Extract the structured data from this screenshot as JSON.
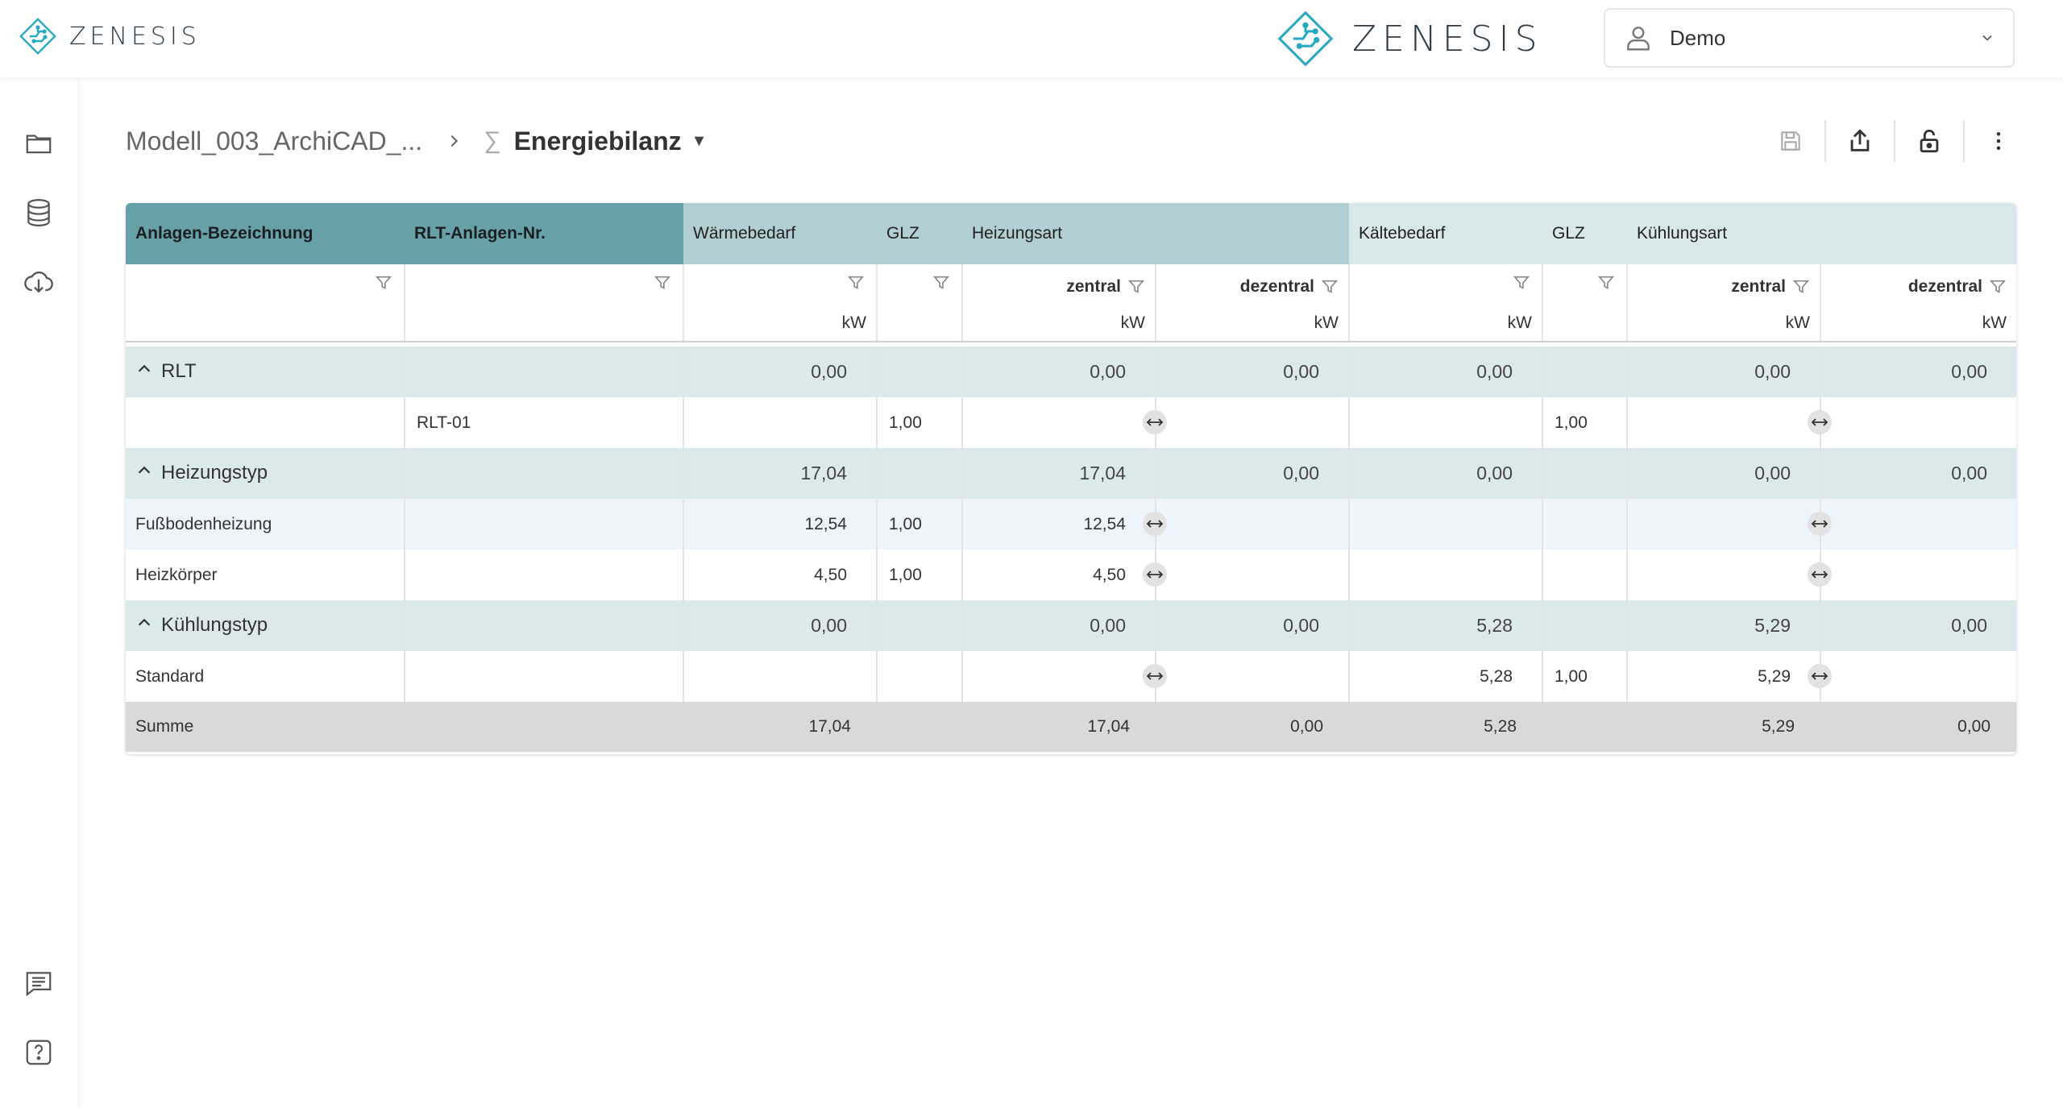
{
  "brand": {
    "name": "ZENESIS"
  },
  "user": {
    "name": "Demo"
  },
  "sidebar": {
    "icons": [
      "folder-icon",
      "database-icon",
      "cloud-download-icon",
      "message-icon",
      "help-icon"
    ]
  },
  "breadcrumb": {
    "model": "Modell_003_ArchiCAD_...",
    "sigma": "∑",
    "current": "Energiebilanz"
  },
  "toolbar": {
    "icons": [
      "save-icon",
      "export-icon",
      "unlock-icon",
      "more-icon"
    ]
  },
  "table": {
    "headers": {
      "anlagen": "Anlagen-Bezeichnung",
      "rlt": "RLT-Anlagen-Nr.",
      "waerme": "Wärmebedarf",
      "glz1": "GLZ",
      "heizungsart": "Heizungsart",
      "kaelte": "Kältebedarf",
      "glz2": "GLZ",
      "kuehlungsart": "Kühlungsart"
    },
    "subheaders": {
      "zentral": "zentral",
      "dezentral": "dezentral",
      "unit": "kW"
    },
    "rows": [
      {
        "type": "group",
        "name": "RLT",
        "rlt": "",
        "waerme": "0,00",
        "glz1": "",
        "hz": "0,00",
        "hd": "0,00",
        "kaelte": "0,00",
        "glz2": "",
        "kz": "0,00",
        "kd": "0,00"
      },
      {
        "type": "item",
        "name": "",
        "rlt": "RLT-01",
        "waerme": "",
        "glz1": "1,00",
        "hz": "",
        "hd": "",
        "kaelte": "",
        "glz2": "1,00",
        "kz": "",
        "kd": ""
      },
      {
        "type": "group",
        "name": "Heizungstyp",
        "rlt": "",
        "waerme": "17,04",
        "glz1": "",
        "hz": "17,04",
        "hd": "0,00",
        "kaelte": "0,00",
        "glz2": "",
        "kz": "0,00",
        "kd": "0,00"
      },
      {
        "type": "item",
        "name": "Fußbodenheizung",
        "rlt": "",
        "waerme": "12,54",
        "glz1": "1,00",
        "hz": "12,54",
        "hd": "",
        "kaelte": "",
        "glz2": "",
        "kz": "",
        "kd": ""
      },
      {
        "type": "item",
        "name": "Heizkörper",
        "rlt": "",
        "waerme": "4,50",
        "glz1": "1,00",
        "hz": "4,50",
        "hd": "",
        "kaelte": "",
        "glz2": "",
        "kz": "",
        "kd": ""
      },
      {
        "type": "group",
        "name": "Kühlungstyp",
        "rlt": "",
        "waerme": "0,00",
        "glz1": "",
        "hz": "0,00",
        "hd": "0,00",
        "kaelte": "5,28",
        "glz2": "",
        "kz": "5,29",
        "kd": "0,00"
      },
      {
        "type": "item",
        "name": "Standard",
        "rlt": "",
        "waerme": "",
        "glz1": "",
        "hz": "",
        "hd": "",
        "kaelte": "5,28",
        "glz2": "1,00",
        "kz": "5,29",
        "kd": ""
      }
    ],
    "summary": {
      "name": "Summe",
      "waerme": "17,04",
      "hz": "17,04",
      "hd": "0,00",
      "kaelte": "5,28",
      "kz": "5,29",
      "kd": "0,00"
    }
  },
  "colors": {
    "header_dark": "#68a0a8",
    "header_mid": "#b1cfd2",
    "header_light": "#d8e7e9",
    "group_row": "#dce9eb",
    "highlight_row": "#edf4fc",
    "summary_row": "#d9d9d9",
    "brand_accent": "#27a9c1"
  }
}
